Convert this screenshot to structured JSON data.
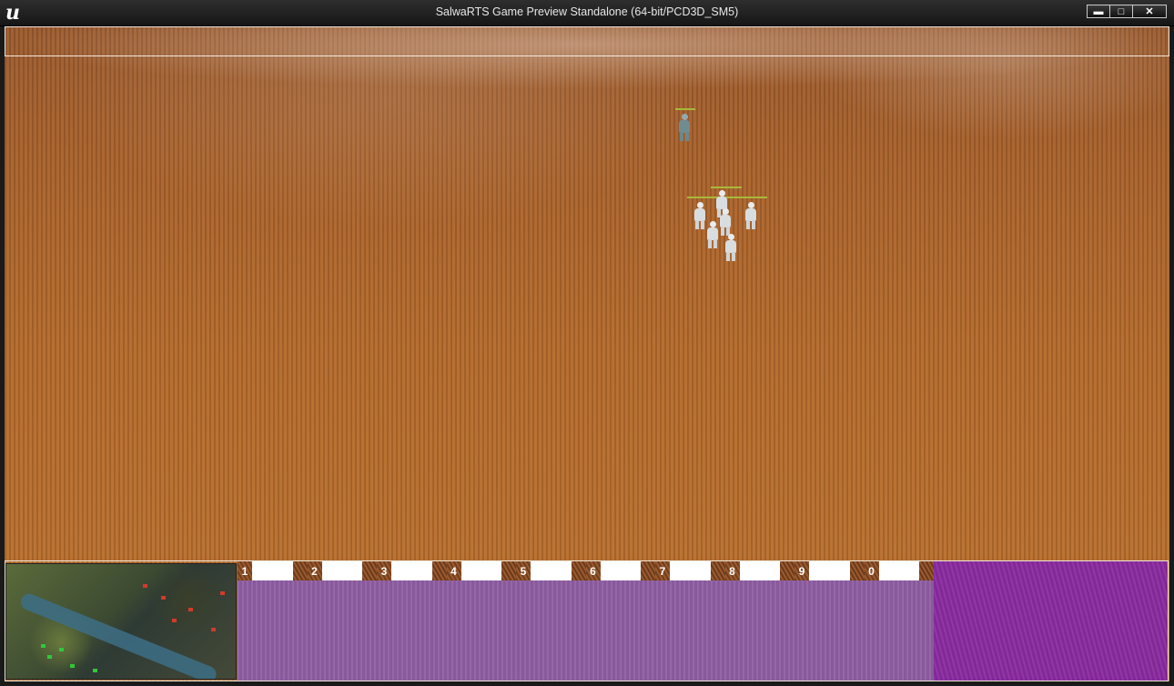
{
  "window": {
    "title": "SalwaRTS Game Preview Standalone (64-bit/PCD3D_SM5)",
    "logo_letter": "u",
    "buttons": {
      "minimize": "▬",
      "maximize": "□",
      "close": "✕"
    }
  },
  "hud": {
    "control_groups": [
      {
        "label": "1"
      },
      {
        "label": "2"
      },
      {
        "label": "3"
      },
      {
        "label": "4"
      },
      {
        "label": "5"
      },
      {
        "label": "6"
      },
      {
        "label": "7"
      },
      {
        "label": "8"
      },
      {
        "label": "9"
      },
      {
        "label": "0"
      }
    ]
  },
  "colors": {
    "terrain": "#b06a2e",
    "command_panel": "#8f5fa3",
    "info_panel": "#8b2aa0",
    "slot_tile": "#8f4e24",
    "health_bar": "#a8b83a"
  }
}
